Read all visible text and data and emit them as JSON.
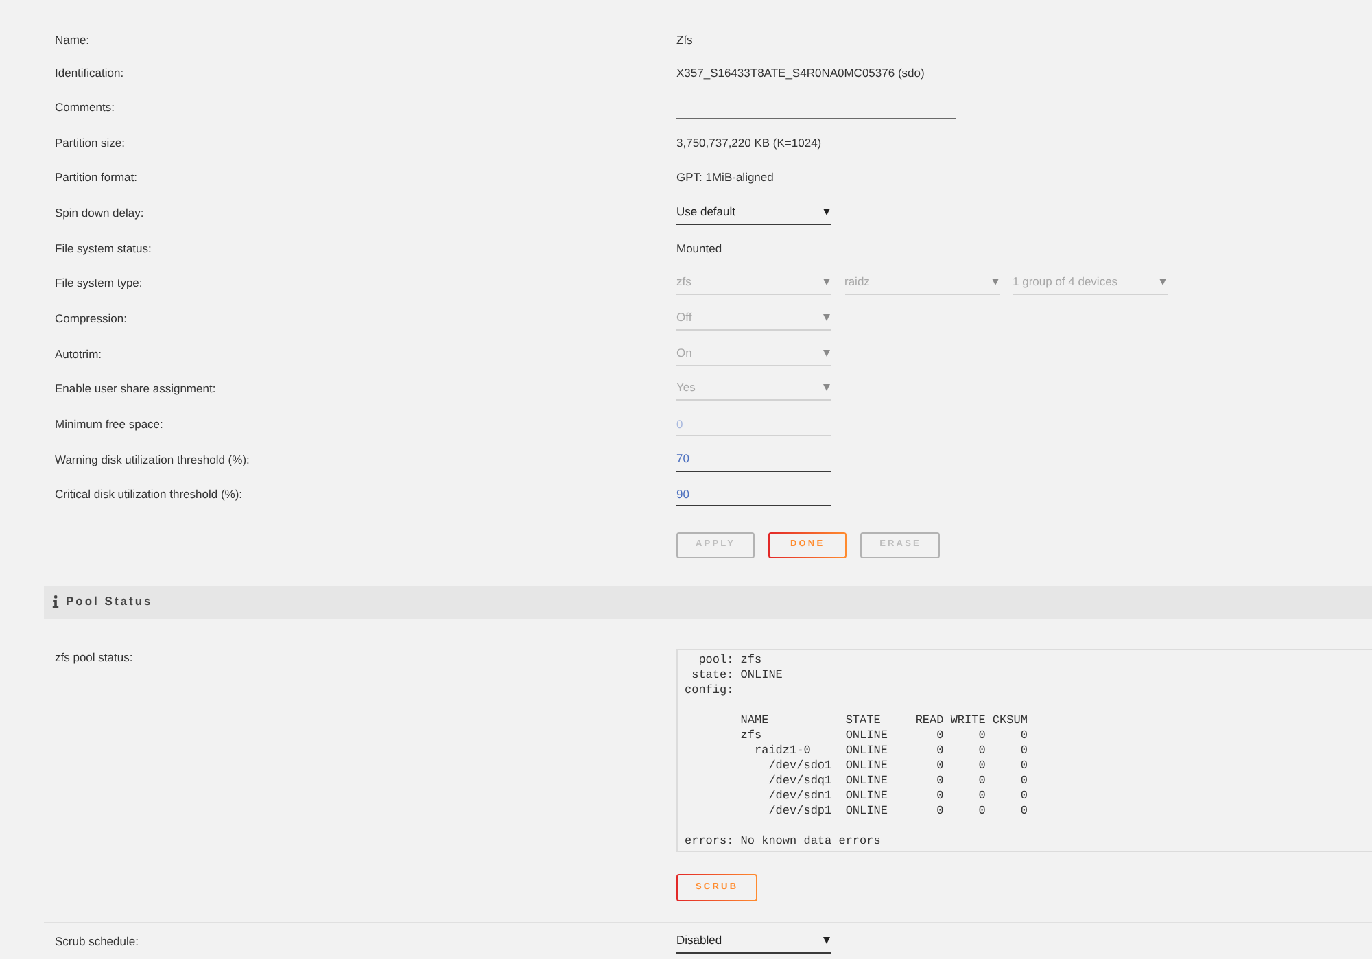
{
  "settings": {
    "fields": [
      {
        "label": "Name:",
        "kind": "text",
        "value": "Zfs"
      },
      {
        "label": "Identification:",
        "kind": "text",
        "value": "X357_S16433T8ATE_S4R0NA0MC05376 (sdo)"
      },
      {
        "label": "Comments:",
        "kind": "comment",
        "disabled": false
      },
      {
        "label": "Partition size:",
        "kind": "text",
        "value": "3,750,737,220 KB (K=1024)"
      },
      {
        "label": "Partition format:",
        "kind": "text",
        "value": "GPT: 1MiB-aligned"
      },
      {
        "label": "Spin down delay:",
        "kind": "select",
        "selects": [
          {
            "value": "Use default",
            "disabled": false
          }
        ]
      },
      {
        "label": "File system status:",
        "kind": "text",
        "value": "Mounted"
      },
      {
        "label": "File system type:",
        "kind": "select",
        "selects": [
          {
            "value": "zfs",
            "disabled": true
          },
          {
            "value": "raidz",
            "disabled": true
          },
          {
            "value": "1 group of 4 devices",
            "disabled": true
          }
        ]
      },
      {
        "label": "Compression:",
        "kind": "select",
        "selects": [
          {
            "value": "Off",
            "disabled": true
          }
        ]
      },
      {
        "label": "Autotrim:",
        "kind": "select",
        "selects": [
          {
            "value": "On",
            "disabled": true
          }
        ]
      },
      {
        "label": "Enable user share assignment:",
        "kind": "select",
        "selects": [
          {
            "value": "Yes",
            "disabled": true
          }
        ]
      },
      {
        "label": "Minimum free space:",
        "kind": "input",
        "value": "0",
        "disabled": true
      },
      {
        "label": "Warning disk utilization threshold (%):",
        "kind": "input",
        "value": "70",
        "disabled": false
      },
      {
        "label": "Critical disk utilization threshold (%):",
        "kind": "input",
        "value": "90",
        "disabled": false
      }
    ],
    "buttons": [
      {
        "label": "APPLY",
        "disabled": true
      },
      {
        "label": "DONE",
        "disabled": false
      },
      {
        "label": "ERASE",
        "disabled": true
      }
    ]
  },
  "pool_status": {
    "title": "Pool Status",
    "label": "zfs pool status:",
    "output": "  pool: zfs\n state: ONLINE\nconfig:\n\n        NAME           STATE     READ WRITE CKSUM\n        zfs            ONLINE       0     0     0\n          raidz1-0     ONLINE       0     0     0\n            /dev/sdo1  ONLINE       0     0     0\n            /dev/sdq1  ONLINE       0     0     0\n            /dev/sdn1  ONLINE       0     0     0\n            /dev/sdp1  ONLINE       0     0     0\n\nerrors: No known data errors",
    "buttons": [
      {
        "label": "SCRUB",
        "disabled": false
      }
    ]
  },
  "scrub_schedule": {
    "label": "Scrub schedule:",
    "kind": "select",
    "selects": [
      {
        "value": "Disabled",
        "disabled": false
      }
    ]
  }
}
